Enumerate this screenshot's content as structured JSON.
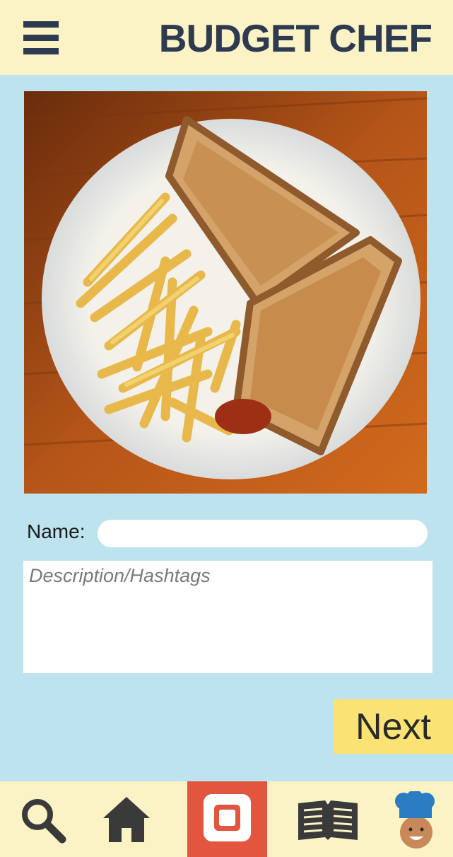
{
  "header": {
    "title": "BUDGET CHEF",
    "menu_icon": "hamburger-menu-icon"
  },
  "form": {
    "name_label": "Name:",
    "name_value": "",
    "description_placeholder": "Description/Hashtags",
    "description_value": ""
  },
  "actions": {
    "next_label": "Next"
  },
  "tabbar": {
    "tabs": [
      {
        "icon": "search-icon",
        "active": false
      },
      {
        "icon": "home-icon",
        "active": false
      },
      {
        "icon": "camera-capture-icon",
        "active": true
      },
      {
        "icon": "recipe-book-icon",
        "active": false
      },
      {
        "icon": "chef-avatar-icon",
        "active": false
      }
    ]
  },
  "colors": {
    "background": "#bde3ee",
    "header_bg": "#fbf3c6",
    "title": "#2e3a4f",
    "next_button": "#fae274",
    "active_tab": "#e2553f"
  }
}
